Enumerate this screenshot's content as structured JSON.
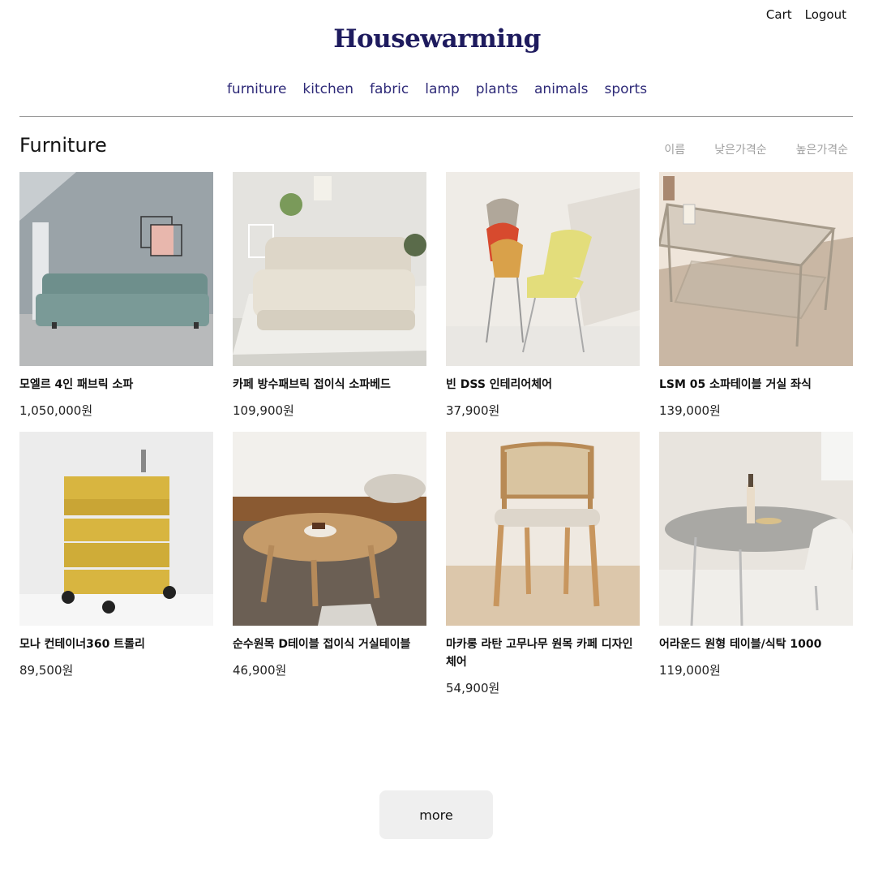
{
  "header": {
    "links": [
      "Cart",
      "Logout"
    ],
    "logo": "Housewarming",
    "nav": [
      "furniture",
      "kitchen",
      "fabric",
      "lamp",
      "plants",
      "animals",
      "sports"
    ]
  },
  "main": {
    "title": "Furniture",
    "sort_options": [
      "이름",
      "낮은가격순",
      "높은가격순"
    ],
    "products": [
      {
        "name": "모엘르 4인 패브릭 소파",
        "price": "1,050,000원",
        "image": "gray-sofa-image"
      },
      {
        "name": "카페 방수패브릭 접이식 소파베드",
        "price": "109,900원",
        "image": "beige-sofabed-image"
      },
      {
        "name": "빈 DSS 인테리어체어",
        "price": "37,900원",
        "image": "stacked-chairs-image"
      },
      {
        "name": "LSM 05 소파테이블 거실 좌식",
        "price": "139,000원",
        "image": "glass-table-image"
      },
      {
        "name": "모나 컨테이너360 트롤리",
        "price": "89,500원",
        "image": "yellow-trolley-image"
      },
      {
        "name": "순수원목 D테이블 접이식 거실테이블",
        "price": "46,900원",
        "image": "wood-table-image"
      },
      {
        "name": "마카롱 라탄 고무나무 원목 카페 디자인체어",
        "price": "54,900원",
        "image": "rattan-chair-image"
      },
      {
        "name": "어라운드 원형 테이블/식탁 1000",
        "price": "119,000원",
        "image": "round-table-image"
      }
    ],
    "more_label": "more"
  },
  "colors": {
    "logo": "#1e1b5e",
    "nav": "#2e2a78",
    "sort": "#a0a0a0",
    "more_bg": "#efefef"
  }
}
